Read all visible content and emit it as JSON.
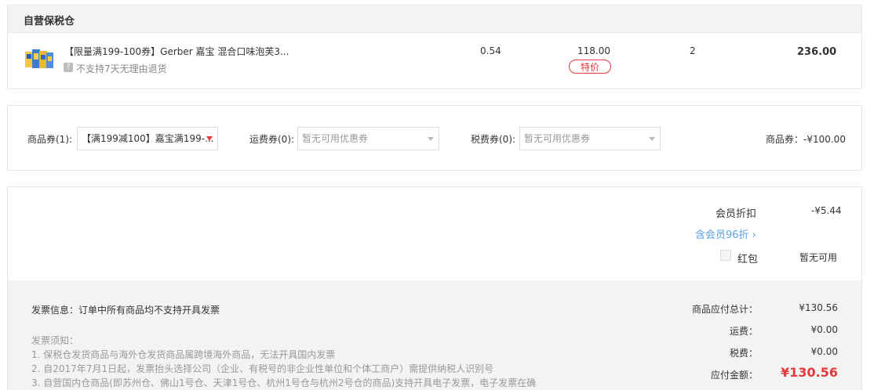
{
  "warehouse": {
    "title": "自营保税仓",
    "product": {
      "thumbnail_icon": "gerber-puffs-thumbnail",
      "title": "【限量满199-100券】Gerber 嘉宝 混合口味泡芙3...",
      "no_return_icon_text": "?",
      "no_return_text": "不支持7天无理由退货",
      "discount": "0.54",
      "unit_price": "118.00",
      "special_badge": "特价",
      "quantity": "2",
      "subtotal": "236.00"
    }
  },
  "coupons": {
    "product_coupon_label": "商品券(1):",
    "product_coupon_value": "【满199减100】嘉宝满199-...",
    "shipping_coupon_label": "运费券(0):",
    "shipping_coupon_placeholder": "暂无可用优惠券",
    "tax_coupon_label": "税费券(0):",
    "tax_coupon_placeholder": "暂无可用优惠券",
    "coupon_total": "商品券：-¥100.00"
  },
  "summary": {
    "member_discount_label": "会员折扣",
    "member_discount_value": "-¥5.44",
    "vip_link": "含会员96折 ›",
    "red_packet_label": "红包",
    "red_packet_value": "暂无可用"
  },
  "invoice": {
    "info": "发票信息：订单中所有商品均不支持开具发票",
    "notes_title": "发票须知：",
    "notes": [
      "1. 保税仓发货商品与海外仓发货商品属跨境海外商品，无法开具国内发票",
      "2. 自2017年7月1日起，发票抬头选择公司（企业、有税号的非企业性单位和个体工商户）需提供纳税人识别号",
      "3. 自营国内仓商品(即苏州仓、佛山1号仓、天津1号仓、杭州1号仓与杭州2号仓的商品)支持开具电子发票，电子发票在确"
    ]
  },
  "totals": {
    "goods_label": "商品应付总计：",
    "goods_value": "¥130.56",
    "shipping_label": "运费：",
    "shipping_value": "¥0.00",
    "tax_label": "税费：",
    "tax_value": "¥0.00",
    "payable_label": "应付金额：",
    "payable_value": "¥130.56"
  },
  "colors": {
    "accent_red": "#e4393c",
    "link_blue": "#5aa2e6",
    "panel_gray": "#f3f3f3"
  }
}
